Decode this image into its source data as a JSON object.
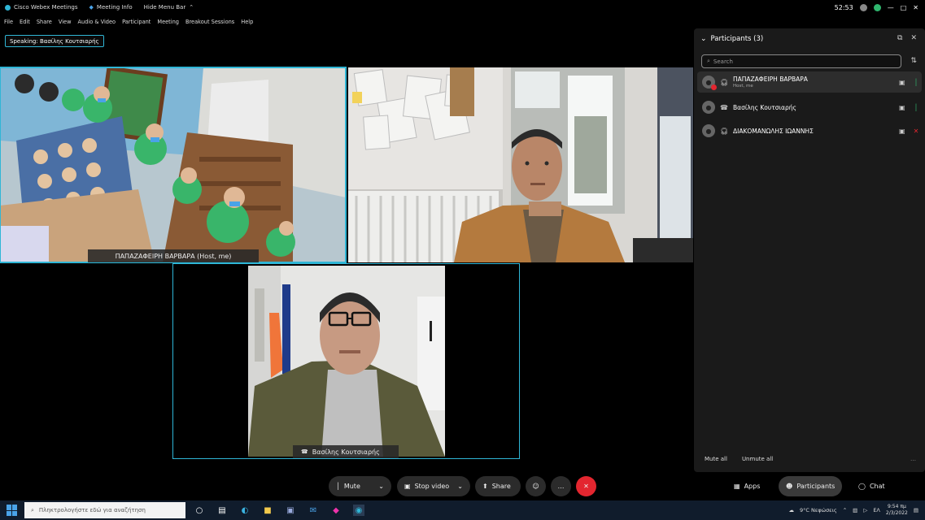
{
  "titlebar": {
    "app": "Cisco Webex Meetings",
    "meeting_info": "Meeting Info",
    "hide_menu": "Hide Menu Bar",
    "timer": "52:53",
    "brand_color": "#2fb6d6"
  },
  "menu": [
    "File",
    "Edit",
    "Share",
    "View",
    "Audio & Video",
    "Participant",
    "Meeting",
    "Breakout Sessions",
    "Help"
  ],
  "speaking": {
    "label": "Speaking: Βασίλης Κουτσιαρής"
  },
  "tiles": {
    "t1": {
      "name": "ΠΑΠΑΖΑΦΕΙΡΗ ΒΑΡΒΑΡΑ (Host, me)"
    },
    "t3": {
      "name": "Βασίλης Κουτσιαρής"
    }
  },
  "participants": {
    "title": "Participants (3)",
    "search_placeholder": "Search",
    "list": [
      {
        "name": "ΠΑΠΑΖΑΦΕΙΡΗ ΒΑΡΒΑΡΑ",
        "sub": "Host, me",
        "mic": "on"
      },
      {
        "name": "Βασίλης Κουτσιαρής",
        "sub": "",
        "mic": "on"
      },
      {
        "name": "ΔΙΑΚΟΜΑΝΩΛΗΣ ΙΩΑΝΝΗΣ",
        "sub": "",
        "mic": "muted"
      }
    ],
    "mute_all": "Mute all",
    "unmute_all": "Unmute all"
  },
  "controls": {
    "mute": "Mute",
    "stop_video": "Stop video",
    "share": "Share",
    "apps": "Apps",
    "participants": "Participants",
    "chat": "Chat"
  },
  "taskbar": {
    "search_placeholder": "Πληκτρολογήστε εδώ για αναζήτηση",
    "weather": "9°C Νεφώσεις",
    "lang": "ΕΛ",
    "time": "9:54 πμ",
    "date": "2/3/2022"
  }
}
